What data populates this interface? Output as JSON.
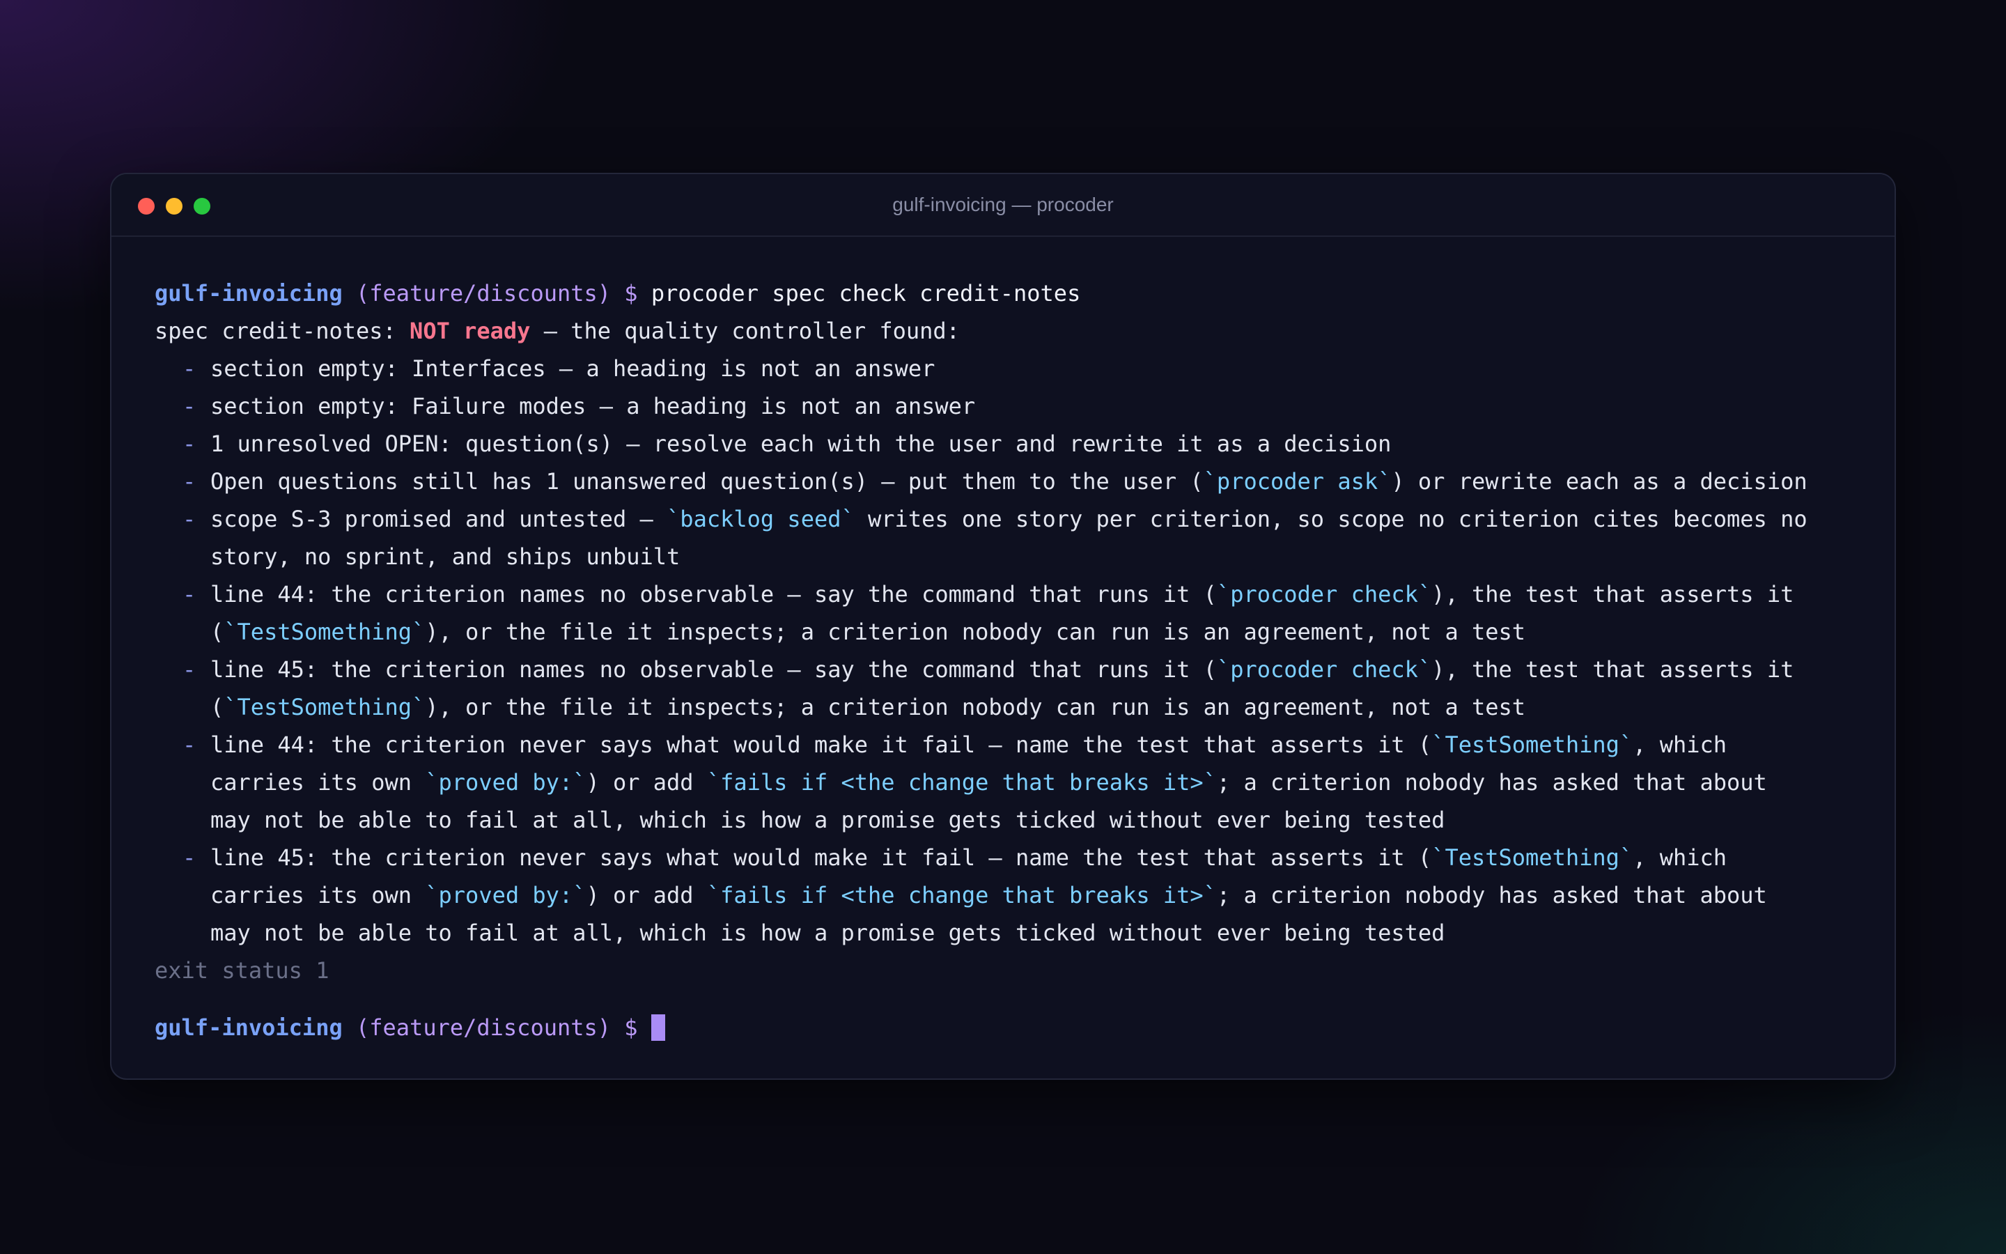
{
  "window": {
    "title": "gulf-invoicing — procoder"
  },
  "prompt": {
    "dir": "gulf-invoicing",
    "branch": "(feature/discounts)",
    "symbol": "$"
  },
  "command": "procoder spec check credit-notes",
  "result": {
    "prefix": "spec credit-notes: ",
    "status": "NOT ready",
    "suffix": " — the quality controller found:"
  },
  "bullet": "-",
  "issues": [
    {
      "lines": [
        [
          {
            "t": "section empty: Interfaces — a heading is not an answer"
          }
        ]
      ]
    },
    {
      "lines": [
        [
          {
            "t": "section empty: Failure modes — a heading is not an answer"
          }
        ]
      ]
    },
    {
      "lines": [
        [
          {
            "t": "1 unresolved OPEN: question(s) — resolve each with the user and rewrite it as a decision"
          }
        ]
      ]
    },
    {
      "lines": [
        [
          {
            "t": "Open questions still has 1 unanswered question(s) — put them to the user ("
          },
          {
            "t": "`procoder ask`",
            "code": true
          },
          {
            "t": ") or rewrite each as a decision"
          }
        ]
      ]
    },
    {
      "lines": [
        [
          {
            "t": "scope S-3 promised and untested — "
          },
          {
            "t": "`backlog seed`",
            "code": true
          },
          {
            "t": " writes one story per criterion, so scope no criterion cites becomes no"
          }
        ],
        [
          {
            "t": "story, no sprint, and ships unbuilt"
          }
        ]
      ]
    },
    {
      "lines": [
        [
          {
            "t": "line 44: the criterion names no observable — say the command that runs it ("
          },
          {
            "t": "`procoder check`",
            "code": true
          },
          {
            "t": "), the test that asserts it"
          }
        ],
        [
          {
            "t": "("
          },
          {
            "t": "`TestSomething`",
            "code": true
          },
          {
            "t": "), or the file it inspects; a criterion nobody can run is an agreement, not a test"
          }
        ]
      ]
    },
    {
      "lines": [
        [
          {
            "t": "line 45: the criterion names no observable — say the command that runs it ("
          },
          {
            "t": "`procoder check`",
            "code": true
          },
          {
            "t": "), the test that asserts it"
          }
        ],
        [
          {
            "t": "("
          },
          {
            "t": "`TestSomething`",
            "code": true
          },
          {
            "t": "), or the file it inspects; a criterion nobody can run is an agreement, not a test"
          }
        ]
      ]
    },
    {
      "lines": [
        [
          {
            "t": "line 44: the criterion never says what would make it fail — name the test that asserts it ("
          },
          {
            "t": "`TestSomething`",
            "code": true
          },
          {
            "t": ", which"
          }
        ],
        [
          {
            "t": "carries its own "
          },
          {
            "t": "`proved by:`",
            "code": true
          },
          {
            "t": ") or add "
          },
          {
            "t": "`fails if <the change that breaks it>`",
            "code": true
          },
          {
            "t": "; a criterion nobody has asked that about"
          }
        ],
        [
          {
            "t": "may not be able to fail at all, which is how a promise gets ticked without ever being tested"
          }
        ]
      ]
    },
    {
      "lines": [
        [
          {
            "t": "line 45: the criterion never says what would make it fail — name the test that asserts it ("
          },
          {
            "t": "`TestSomething`",
            "code": true
          },
          {
            "t": ", which"
          }
        ],
        [
          {
            "t": "carries its own "
          },
          {
            "t": "`proved by:`",
            "code": true
          },
          {
            "t": ") or add "
          },
          {
            "t": "`fails if <the change that breaks it>`",
            "code": true
          },
          {
            "t": "; a criterion nobody has asked that about"
          }
        ],
        [
          {
            "t": "may not be able to fail at all, which is how a promise gets ticked without ever being tested"
          }
        ]
      ]
    }
  ],
  "exit_status": "exit status 1",
  "colors": {
    "prompt_dir": "#7aa2f7",
    "prompt_branch": "#bb9af7",
    "status_error": "#f7768e",
    "code": "#7dcfff",
    "dim": "#6b7089",
    "cursor": "#a98cf5"
  }
}
